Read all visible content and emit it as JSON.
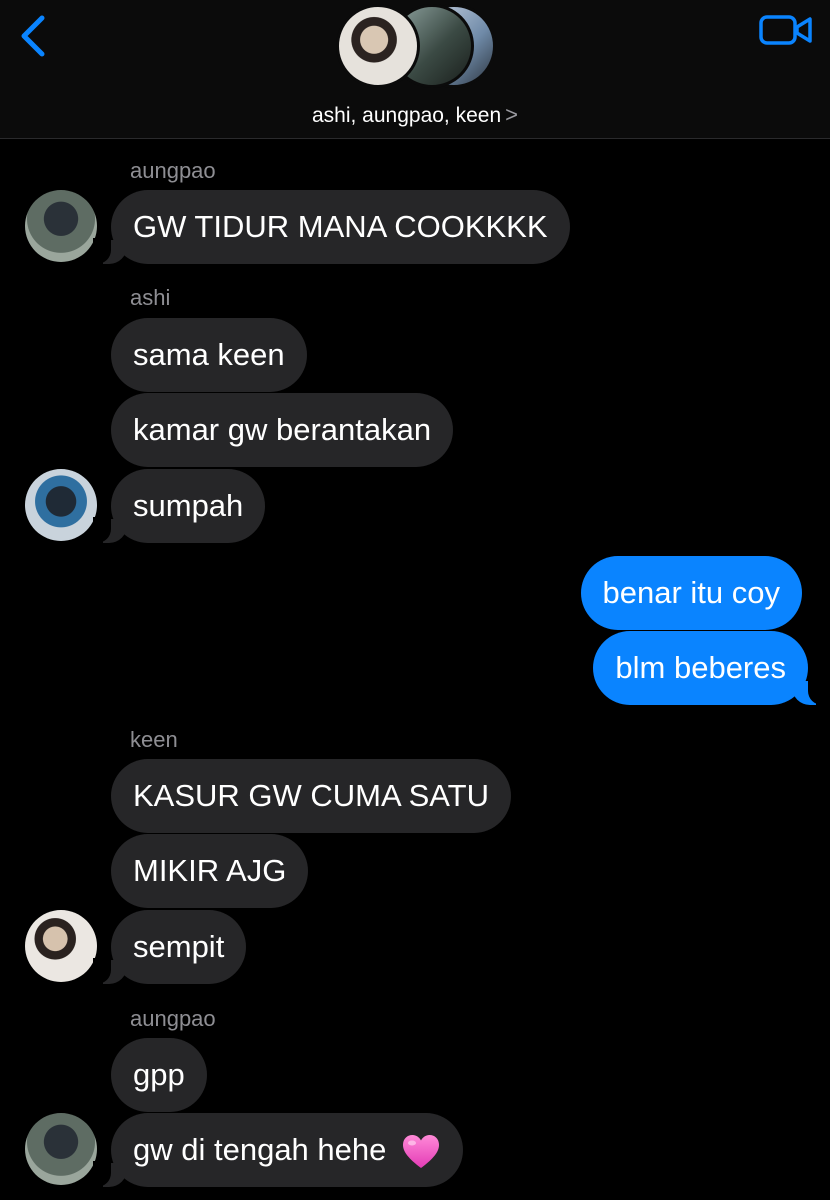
{
  "header": {
    "group_title": "ashi, aungpao, keen",
    "chevron": ">",
    "back_icon": "chevron-left-icon",
    "video_icon": "video-camera-icon"
  },
  "colors": {
    "accent": "#0a84ff",
    "incoming_bubble": "#262628",
    "sender_label": "#8e8e93"
  },
  "messages": [
    {
      "sender": "aungpao",
      "text": "GW TIDUR MANA COOKKKK"
    },
    {
      "sender": "ashi",
      "text": "sama keen"
    },
    {
      "text": "kamar gw berantakan"
    },
    {
      "text": "sumpah"
    },
    {
      "outgoing": true,
      "text": "benar itu coy"
    },
    {
      "outgoing": true,
      "text": "blm beberes"
    },
    {
      "sender": "keen",
      "text": "KASUR GW CUMA SATU"
    },
    {
      "text": "MIKIR AJG"
    },
    {
      "text": "sempit"
    },
    {
      "sender": "aungpao",
      "text": "gpp"
    },
    {
      "text": "gw di tengah hehe",
      "emoji": "pink-heart"
    }
  ]
}
